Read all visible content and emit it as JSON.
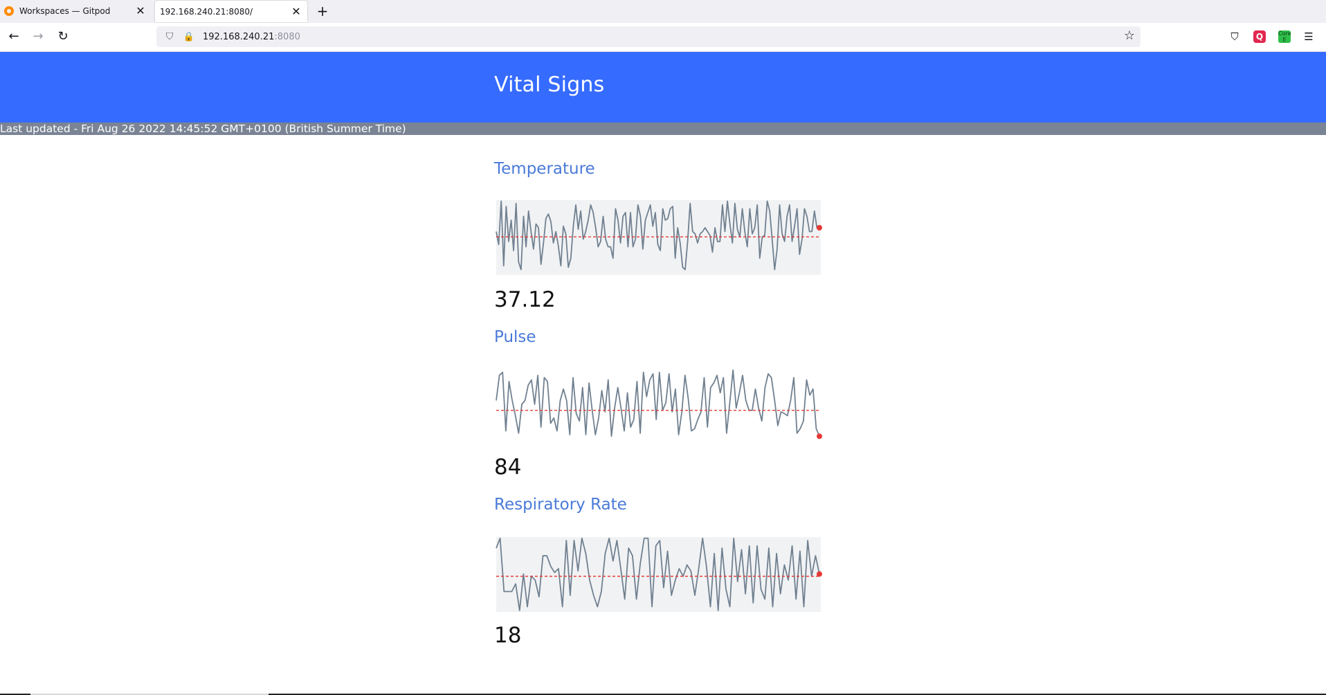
{
  "browser": {
    "tabs": [
      {
        "title": "Workspaces — Gitpod",
        "active": false
      },
      {
        "title": "192.168.240.21:8080/",
        "active": true
      }
    ],
    "url_host": "192.168.240.21",
    "url_port": ":8080",
    "icons": {
      "back": "←",
      "forward": "→",
      "reload": "↻",
      "shield": "⛉",
      "lock": "🔒",
      "star": "☆",
      "pocket": "⛉",
      "menu": "☰",
      "new_tab": "+",
      "close": "✕",
      "ext1": "Q",
      "ext2": "Core E"
    }
  },
  "header": {
    "title": "Vital Signs",
    "background": "#356bff"
  },
  "status": {
    "last_updated": "Last updated - Fri Aug 26 2022 14:45:52 GMT+0100 (British Summer Time)"
  },
  "chart_data": [
    {
      "type": "line",
      "name": "Temperature",
      "current": "37.12",
      "line_color": "#708090",
      "fill_color": "#f1f2f4",
      "reference_color": "#e53935",
      "reference_y": 0.48,
      "values": [
        0.55,
        0.38,
        0.95,
        0.1,
        0.88,
        0.42,
        0.7,
        0.3,
        0.92,
        0.15,
        0.05,
        0.75,
        0.35,
        0.82,
        0.55,
        0.32,
        0.65,
        0.6,
        0.12,
        0.4,
        0.72,
        0.78,
        0.68,
        0.4,
        0.55,
        0.36,
        0.1,
        0.62,
        0.52,
        0.08,
        0.2,
        0.62,
        0.9,
        0.58,
        0.82,
        0.45,
        0.55,
        0.7,
        0.9,
        0.8,
        0.6,
        0.35,
        0.42,
        0.75,
        0.45,
        0.35,
        0.35,
        0.2,
        0.85,
        0.7,
        0.4,
        0.75,
        0.8,
        0.35,
        0.8,
        0.35,
        0.45,
        0.9,
        0.75,
        0.32,
        0.7,
        0.8,
        0.9,
        0.62,
        0.8,
        0.38,
        0.3,
        0.85,
        0.7,
        0.72,
        0.85,
        0.88,
        0.2,
        0.6,
        0.4,
        0.08,
        0.05,
        0.42,
        0.92,
        0.55,
        0.52,
        0.4,
        0.52,
        0.55,
        0.6,
        0.55,
        0.5,
        0.28,
        0.6,
        0.42,
        0.42,
        0.9,
        0.55,
        0.95,
        0.65,
        0.4,
        0.92,
        0.58,
        0.48,
        0.85,
        0.55,
        0.35,
        0.85,
        0.52,
        0.6,
        0.9,
        0.2,
        0.48,
        0.5,
        0.95,
        0.82,
        0.45,
        0.05,
        0.32,
        0.9,
        0.52,
        0.42,
        0.75,
        0.9,
        0.42,
        0.62,
        0.85,
        0.25,
        0.45,
        0.85,
        0.75,
        0.55,
        0.55,
        0.82,
        0.6
      ],
      "last_point_y": 0.6
    },
    {
      "type": "line",
      "name": "Pulse",
      "current": "84",
      "line_color": "#708090",
      "reference_color": "#e53935",
      "reference_y": 0.42,
      "values": [
        0.55,
        0.88,
        0.92,
        0.15,
        0.8,
        0.55,
        0.35,
        0.12,
        0.5,
        0.55,
        0.75,
        0.82,
        0.5,
        0.88,
        0.2,
        0.85,
        0.8,
        0.25,
        0.32,
        0.15,
        0.55,
        0.7,
        0.55,
        0.1,
        0.85,
        0.38,
        0.28,
        0.72,
        0.1,
        0.78,
        0.42,
        0.1,
        0.32,
        0.68,
        0.4,
        0.82,
        0.08,
        0.45,
        0.72,
        0.45,
        0.15,
        0.65,
        0.2,
        0.3,
        0.8,
        0.12,
        0.92,
        0.6,
        0.82,
        0.9,
        0.3,
        0.92,
        0.42,
        0.52,
        0.9,
        0.4,
        0.7,
        0.1,
        0.4,
        0.88,
        0.58,
        0.15,
        0.18,
        0.3,
        0.4,
        0.85,
        0.2,
        0.72,
        0.78,
        0.88,
        0.65,
        0.85,
        0.12,
        0.52,
        0.95,
        0.45,
        0.65,
        0.88,
        0.55,
        0.42,
        0.42,
        0.7,
        0.45,
        0.28,
        0.72,
        0.9,
        0.85,
        0.55,
        0.22,
        0.4,
        0.38,
        0.35,
        0.55,
        0.85,
        0.12,
        0.18,
        0.28,
        0.82,
        0.62,
        0.7,
        0.18
      ],
      "last_point_y": 0.08
    },
    {
      "type": "line",
      "name": "Respiratory Rate",
      "current": "18",
      "line_color": "#708090",
      "fill_color": "#f1f2f4",
      "reference_color": "#e53935",
      "reference_y": 0.45,
      "values": [
        0.82,
        0.95,
        0.25,
        0.25,
        0.25,
        0.35,
        0.0,
        0.48,
        0.05,
        0.45,
        0.4,
        0.18,
        0.72,
        0.72,
        0.58,
        0.5,
        0.55,
        0.05,
        0.92,
        0.2,
        0.92,
        0.52,
        0.95,
        0.75,
        0.4,
        0.2,
        0.05,
        0.25,
        0.75,
        0.95,
        0.65,
        0.92,
        0.55,
        0.15,
        0.82,
        0.72,
        0.15,
        0.62,
        0.95,
        0.95,
        0.05,
        0.85,
        0.92,
        0.3,
        0.78,
        0.2,
        0.4,
        0.55,
        0.45,
        0.6,
        0.52,
        0.2,
        0.55,
        0.95,
        0.58,
        0.05,
        0.75,
        0.0,
        0.82,
        0.28,
        0.05,
        0.95,
        0.38,
        0.8,
        0.22,
        0.85,
        0.1,
        0.85,
        0.28,
        0.15,
        0.82,
        0.05,
        0.75,
        0.22,
        0.6,
        0.4,
        0.85,
        0.15,
        0.78,
        0.05,
        0.92,
        0.45,
        0.72
      ],
      "last_point_y": 0.48
    }
  ]
}
